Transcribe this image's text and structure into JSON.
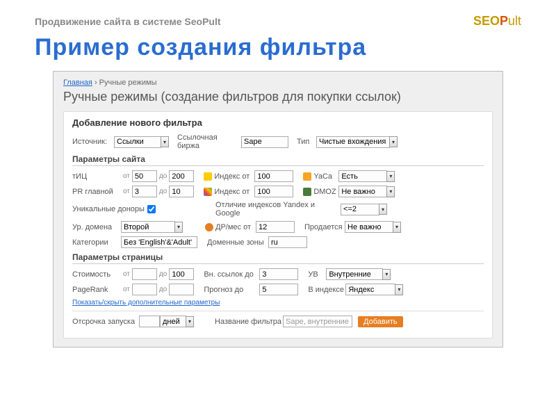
{
  "header": {
    "subtitle": "Продвижение сайта в системе SeoPult",
    "logo_seo": "SEO",
    "logo_p": "P",
    "logo_ult": "ult"
  },
  "title": "Пример создания фильтра",
  "breadcrumb": {
    "home": "Главная",
    "sep": "›",
    "current": "Ручные режимы"
  },
  "page_head": "Ручные режимы (создание фильтров для покупки ссылок)",
  "form_title": "Добавление нового фильтра",
  "top": {
    "source_label": "Источник:",
    "source_value": "Ссылки",
    "exchange_label": "Ссылочная биржа",
    "exchange_value": "Sape",
    "type_label": "Тип",
    "type_value": "Чистые вхождения"
  },
  "sect1": "Параметры сайта",
  "site": {
    "tic_label": "тИЦ",
    "tic_from": "50",
    "tic_to": "200",
    "ya_index_label": "Индекс от",
    "ya_index": "100",
    "yaca_label": "YaCa",
    "yaca_value": "Есть",
    "pr_label": "PR главной",
    "pr_from": "3",
    "pr_to": "10",
    "g_index_label": "Индекс от",
    "g_index": "100",
    "dmoz_label": "DMOZ",
    "dmoz_value": "Не важно",
    "unique_label": "Уникальные доноры",
    "diff_label": "Отличие индексов Yandex и Google",
    "diff_value": "<=2",
    "domain_level_label": "Ур. домена",
    "domain_level_value": "Второй",
    "age_label": "ДР/мес от",
    "age": "12",
    "sale_label": "Продается",
    "sale_value": "Не важно",
    "cat_label": "Категории",
    "cat_value": "Без 'English'&'Adult'",
    "zones_label": "Доменные зоны",
    "zones_value": "ru"
  },
  "sect2": "Параметры страницы",
  "page": {
    "cost_label": "Стоимость",
    "cost_from": "",
    "cost_to": "100",
    "ext_links_label": "Вн. ссылок до",
    "ext_links": "3",
    "uv_label": "УВ",
    "uv_value": "Внутренние",
    "pr_label": "PageRank",
    "pr_from": "",
    "pr_to": "",
    "forecast_label": "Прогноз до",
    "forecast": "5",
    "inindex_label": "В индексе",
    "inindex_value": "Яндекс",
    "toggle_link": "Показать/скрыть дополнительные параметры"
  },
  "footer": {
    "delay_label": "Отсрочка запуска",
    "delay_value": "",
    "delay_unit": "дней",
    "name_label": "Название фильтра",
    "name_value": "Sape, внутренние",
    "add_btn": "Добавить"
  },
  "ot": "от",
  "do": "до"
}
